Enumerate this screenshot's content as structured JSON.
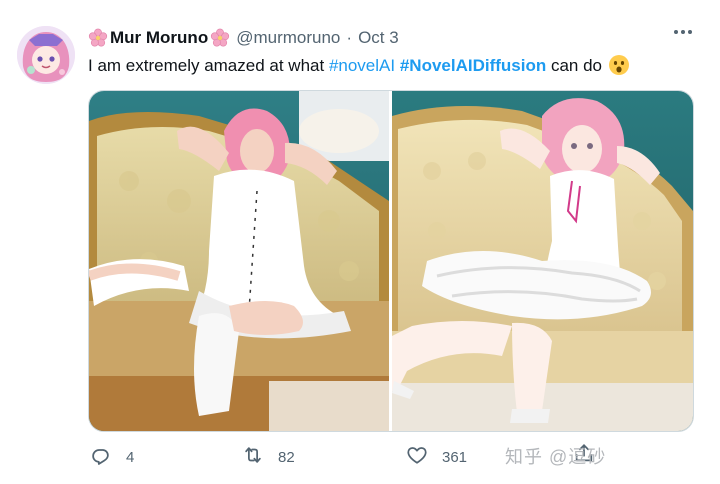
{
  "tweet": {
    "display_name": "Mur Moruno",
    "handle": "@murmoruno",
    "separator": "·",
    "date": "Oct 3",
    "text_before": "I am extremely amazed at what ",
    "hashtag_1": "#novelAI",
    "hashtag_2": "#NovelAIDiffusion",
    "text_after": " can do",
    "emoji": "astonished-face-emoji",
    "icons": [
      "cherry-blossom-icon",
      "more-options-icon",
      "reply-icon",
      "retweet-icon",
      "like-icon",
      "share-icon"
    ]
  },
  "media": {
    "images": [
      "cosplay-photo",
      "anime-rendering"
    ]
  },
  "actions": {
    "reply_count": "4",
    "retweet_count": "82",
    "like_count": "361"
  },
  "watermark": "知乎 @逗砂",
  "colors": {
    "link": "#1d9bf0",
    "secondary_text": "#536471",
    "border": "#cfd9de",
    "text": "#0f1419"
  }
}
